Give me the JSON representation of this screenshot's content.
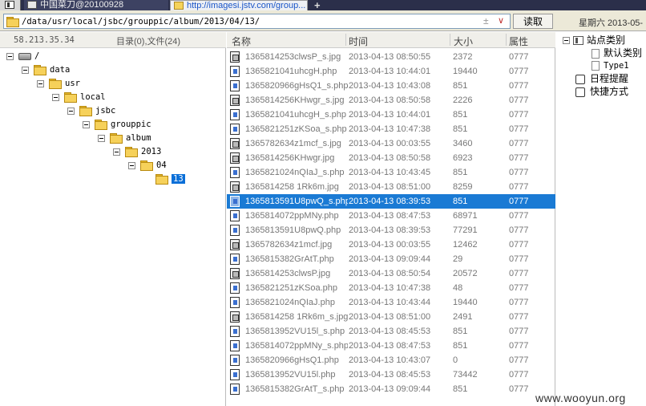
{
  "tabs": [
    {
      "label": "中国菜刀@20100928"
    },
    {
      "label": "http://imagesi.jstv.com/group..."
    }
  ],
  "tab_add_label": "+",
  "address": {
    "path": "/data/usr/local/jsbc/grouppic/album/2013/04/13/",
    "plus": "±",
    "dropdown": "∨"
  },
  "read_button": "读取",
  "date_text": "星期六 2013-05-",
  "left_header": {
    "ip": "58.213.35.34",
    "counts": "目录(0),文件(24)"
  },
  "tree": [
    {
      "label": "/",
      "depth": 0,
      "icon": "drive-icon"
    },
    {
      "label": "data",
      "depth": 1
    },
    {
      "label": "usr",
      "depth": 2
    },
    {
      "label": "local",
      "depth": 3
    },
    {
      "label": "jsbc",
      "depth": 4
    },
    {
      "label": "grouppic",
      "depth": 5
    },
    {
      "label": "album",
      "depth": 6
    },
    {
      "label": "2013",
      "depth": 7
    },
    {
      "label": "04",
      "depth": 8
    },
    {
      "label": "13",
      "depth": 9,
      "selected": true
    }
  ],
  "columns": {
    "name": "名称",
    "time": "时间",
    "size": "大小",
    "attr": "属性"
  },
  "files": [
    {
      "name": "1365814253clwsP_s.jpg",
      "time": "2013-04-13 08:50:55",
      "size": "2372",
      "attr": "0777",
      "type": "jpg"
    },
    {
      "name": "1365821041uhcgH.php",
      "time": "2013-04-13 10:44:01",
      "size": "19440",
      "attr": "0777",
      "type": "php"
    },
    {
      "name": "1365820966gHsQ1_s.php",
      "time": "2013-04-13 10:43:08",
      "size": "851",
      "attr": "0777",
      "type": "php"
    },
    {
      "name": "1365814256KHwgr_s.jpg",
      "time": "2013-04-13 08:50:58",
      "size": "2226",
      "attr": "0777",
      "type": "jpg"
    },
    {
      "name": "1365821041uhcgH_s.php",
      "time": "2013-04-13 10:44:01",
      "size": "851",
      "attr": "0777",
      "type": "php"
    },
    {
      "name": "1365821251zKSoa_s.php",
      "time": "2013-04-13 10:47:38",
      "size": "851",
      "attr": "0777",
      "type": "php"
    },
    {
      "name": "1365782634z1mcf_s.jpg",
      "time": "2013-04-13 00:03:55",
      "size": "3460",
      "attr": "0777",
      "type": "jpg"
    },
    {
      "name": "1365814256KHwgr.jpg",
      "time": "2013-04-13 08:50:58",
      "size": "6923",
      "attr": "0777",
      "type": "jpg"
    },
    {
      "name": "1365821024nQIaJ_s.php",
      "time": "2013-04-13 10:43:45",
      "size": "851",
      "attr": "0777",
      "type": "php"
    },
    {
      "name": "1365814258 1Rk6m.jpg",
      "time": "2013-04-13 08:51:00",
      "size": "8259",
      "attr": "0777",
      "type": "jpg"
    },
    {
      "name": "1365813591U8pwQ_s.php",
      "time": "2013-04-13 08:39:53",
      "size": "851",
      "attr": "0777",
      "type": "php",
      "selected": true
    },
    {
      "name": "1365814072ppMNy.php",
      "time": "2013-04-13 08:47:53",
      "size": "68971",
      "attr": "0777",
      "type": "php"
    },
    {
      "name": "1365813591U8pwQ.php",
      "time": "2013-04-13 08:39:53",
      "size": "77291",
      "attr": "0777",
      "type": "php"
    },
    {
      "name": "1365782634z1mcf.jpg",
      "time": "2013-04-13 00:03:55",
      "size": "12462",
      "attr": "0777",
      "type": "jpg"
    },
    {
      "name": "1365815382GrAtT.php",
      "time": "2013-04-13 09:09:44",
      "size": "29",
      "attr": "0777",
      "type": "php"
    },
    {
      "name": "1365814253clwsP.jpg",
      "time": "2013-04-13 08:50:54",
      "size": "20572",
      "attr": "0777",
      "type": "jpg"
    },
    {
      "name": "1365821251zKSoa.php",
      "time": "2013-04-13 10:47:38",
      "size": "48",
      "attr": "0777",
      "type": "php"
    },
    {
      "name": "1365821024nQIaJ.php",
      "time": "2013-04-13 10:43:44",
      "size": "19440",
      "attr": "0777",
      "type": "php"
    },
    {
      "name": "1365814258 1Rk6m_s.jpg",
      "time": "2013-04-13 08:51:00",
      "size": "2491",
      "attr": "0777",
      "type": "jpg"
    },
    {
      "name": "1365813952VU15l_s.php",
      "time": "2013-04-13 08:45:53",
      "size": "851",
      "attr": "0777",
      "type": "php"
    },
    {
      "name": "1365814072ppMNy_s.php",
      "time": "2013-04-13 08:47:53",
      "size": "851",
      "attr": "0777",
      "type": "php"
    },
    {
      "name": "1365820966gHsQ1.php",
      "time": "2013-04-13 10:43:07",
      "size": "0",
      "attr": "0777",
      "type": "php"
    },
    {
      "name": "1365813952VU15l.php",
      "time": "2013-04-13 08:45:53",
      "size": "73442",
      "attr": "0777",
      "type": "php"
    },
    {
      "name": "1365815382GrAtT_s.php",
      "time": "2013-04-13 09:09:44",
      "size": "851",
      "attr": "0777",
      "type": "php"
    }
  ],
  "right_panel": {
    "site_category": "站点类别",
    "default_category": "默认类别",
    "type1": "Type1",
    "schedule": "日程提醒",
    "shortcuts": "快捷方式"
  },
  "watermark": "www.wooyun.org",
  "colors": {
    "selection": "#1a7ad4",
    "tree_selection": "#0a6fd8",
    "tab_url": "#1a55c8"
  }
}
